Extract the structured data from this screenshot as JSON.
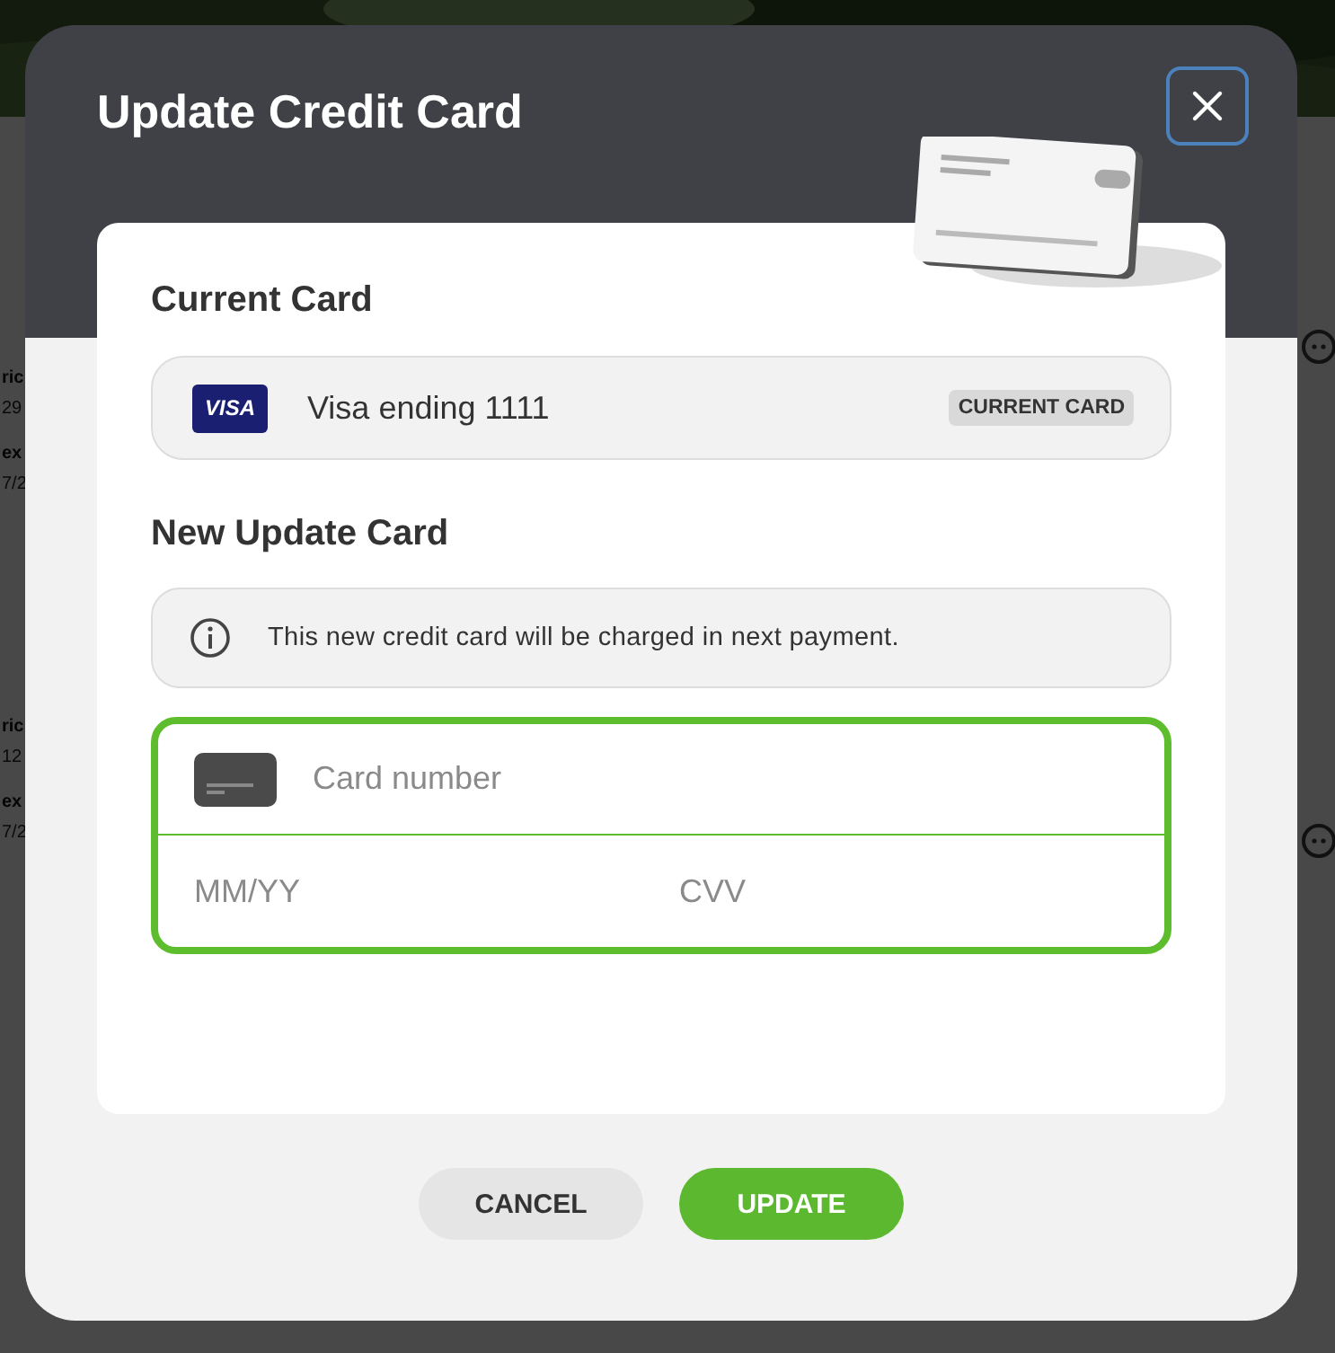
{
  "background": {
    "fragments": [
      {
        "label": "ric",
        "value": "29"
      },
      {
        "label": "ex",
        "value": "7/2"
      },
      {
        "label": "ric",
        "value": "12"
      },
      {
        "label": "ex",
        "value": "7/2"
      }
    ]
  },
  "dialog": {
    "title": "Update Credit Card",
    "current_card": {
      "heading": "Current Card",
      "brand": "VISA",
      "label": "Visa ending 1111",
      "badge": "CURRENT CARD"
    },
    "new_card": {
      "heading": "New Update Card",
      "notice": "This new credit card will be charged in next payment.",
      "fields": [
        {
          "kind": "card",
          "placeholder": "Card number"
        },
        {
          "kind": "half",
          "placeholder": "MM/YY"
        },
        {
          "kind": "half",
          "placeholder": "CVV"
        }
      ]
    },
    "buttons": [
      {
        "kind": "secondary",
        "label": "CANCEL"
      },
      {
        "kind": "primary",
        "label": "UPDATE"
      }
    ]
  }
}
